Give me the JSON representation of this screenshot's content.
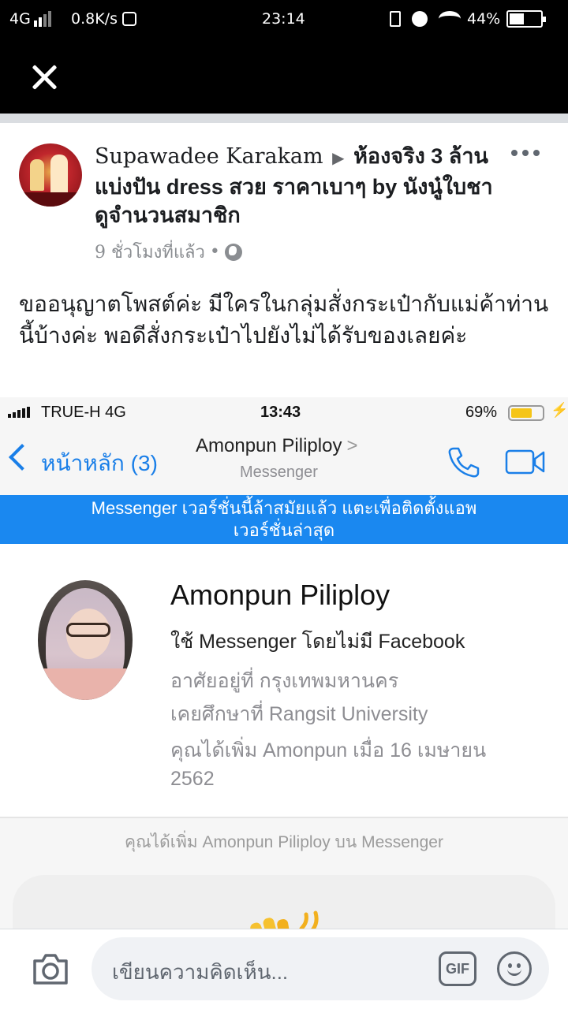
{
  "status_bar": {
    "network": "4G",
    "speed": "0.8K/s",
    "time": "23:14",
    "battery": "44%",
    "battery_level": 0.44
  },
  "post": {
    "author": "Supawadee Karakam",
    "group": "ห้องจริง 3 ล้าน แบ่งปัน  dress สวย ราคาเบาๆ by นังนู๋ใบชา ดูจำนวนสมาชิก",
    "time": "9 ชั่วโมงที่แล้ว",
    "separator": "•",
    "body": "ขออนุญาตโพสต์ค่ะ มีใครในกลุ่มสั่งกระเป๋ากับแม่ค้าท่านนี้บ้างค่ะ พอดีสั่งกระเป๋าไปยังไม่ได้รับของเลยค่ะ"
  },
  "screenshot": {
    "status": {
      "carrier": "TRUE-H   4G",
      "time": "13:43",
      "battery": "69%",
      "battery_level": 0.69
    },
    "nav": {
      "back_label": "หน้าหลัก (3)",
      "name": "Amonpun Piliploy",
      "chevron": ">",
      "subtitle": "Messenger"
    },
    "banner": {
      "line1": "Messenger เวอร์ชั่นนี้ล้าสมัยแล้ว แตะเพื่อติดตั้งแอพ",
      "line2": "เวอร์ชั่นล่าสุด"
    },
    "profile": {
      "name": "Amonpun Piliploy",
      "messenger_only": "ใช้ Messenger โดยไม่มี Facebook",
      "lives_in": "อาศัยอยู่ที่ กรุงเทพมหานคร",
      "studied_at": "เคยศึกษาที่ Rangsit University",
      "added": "คุณได้เพิ่ม Amonpun เมื่อ 16 เมษายน 2562"
    },
    "added_note": "คุณได้เพิ่ม Amonpun Piliploy บน Messenger"
  },
  "composer": {
    "placeholder": "เขียนความคิดเห็น...",
    "gif_label": "GIF"
  },
  "colors": {
    "messenger_blue": "#1a7fe8",
    "banner_blue": "#1a88f0",
    "battery_yellow": "#f5c518"
  },
  "icons": [
    "close-icon",
    "more-icon",
    "globe-icon",
    "phone-icon",
    "video-icon",
    "wave-icon",
    "camera-icon",
    "gif-icon",
    "emoji-icon"
  ]
}
